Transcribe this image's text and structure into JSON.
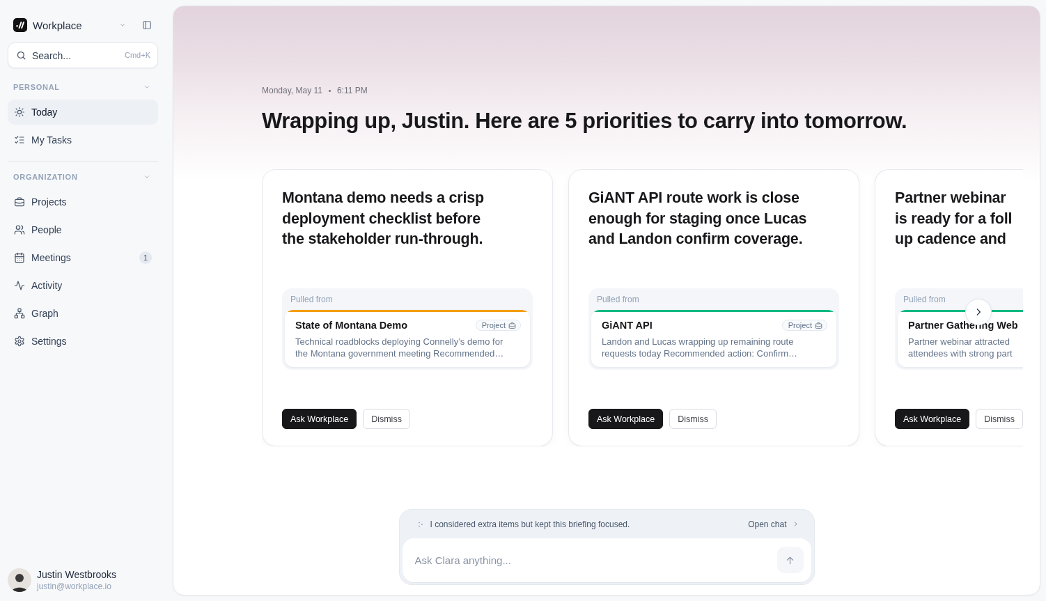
{
  "sidebar": {
    "workspace": {
      "name": "Workplace"
    },
    "search": {
      "placeholder": "Search...",
      "shortcut": "Cmd+K"
    },
    "sections": [
      {
        "title": "PERSONAL",
        "expanded": true,
        "items": [
          {
            "label": "Today",
            "selected": true
          },
          {
            "label": "My Tasks",
            "selected": false
          }
        ]
      },
      {
        "title": "ORGANIZATION",
        "expanded": true,
        "items": [
          {
            "label": "Projects",
            "selected": false
          },
          {
            "label": "People",
            "selected": false
          },
          {
            "label": "Meetings",
            "selected": false,
            "badge": "1"
          },
          {
            "label": "Activity",
            "selected": false
          },
          {
            "label": "Graph",
            "selected": false
          },
          {
            "label": "Settings",
            "selected": false
          }
        ]
      }
    ],
    "user": {
      "name": "Justin Westbrooks",
      "email": "justin@workplace.io"
    }
  },
  "briefing": {
    "date": "Monday, May 11",
    "time": "6:11 PM",
    "heading": "Wrapping up, Justin. Here are 5 priorities to carry into tomorrow.",
    "cards": [
      {
        "title_lines": [
          "Montana demo needs a crisp",
          "deployment checklist before",
          "the stakeholder run-through."
        ],
        "source": {
          "label": "Pulled from",
          "title": "State of Montana Demo",
          "tag": "Project",
          "color": "#f59e0b",
          "description_lines": [
            "Technical roadblocks deploying Connelly’s demo for",
            "the Montana government meeting Recommended…"
          ]
        },
        "actions": [
          {
            "label": "Ask Workplace",
            "kind": "primary"
          },
          {
            "label": "Dismiss",
            "kind": "secondary"
          }
        ]
      },
      {
        "title_lines": [
          "GiANT API route work is close",
          "enough for staging once Lucas",
          "and Landon confirm coverage."
        ],
        "source": {
          "label": "Pulled from",
          "title": "GiANT API",
          "tag": "Project",
          "color": "#10b981",
          "description_lines": [
            "Landon and Lucas wrapping up remaining route",
            "requests today Recommended action: Confirm…"
          ]
        },
        "actions": [
          {
            "label": "Ask Workplace",
            "kind": "primary"
          },
          {
            "label": "Dismiss",
            "kind": "secondary"
          }
        ]
      },
      {
        "title_lines": [
          "Partner webinar",
          "is ready for a foll",
          "up cadence and"
        ],
        "source": {
          "label": "Pulled from",
          "title": "Partner Gathering Web",
          "color": "#10b981",
          "description_lines": [
            "Partner webinar attracted",
            "attendees with strong part"
          ]
        },
        "actions": [
          {
            "label": "Ask Workplace",
            "kind": "primary"
          },
          {
            "label": "Dismiss",
            "kind": "secondary"
          }
        ]
      }
    ]
  },
  "chat": {
    "note": "I considered extra items but kept this briefing focused.",
    "open_link": "Open chat",
    "placeholder": "Ask Clara anything..."
  }
}
